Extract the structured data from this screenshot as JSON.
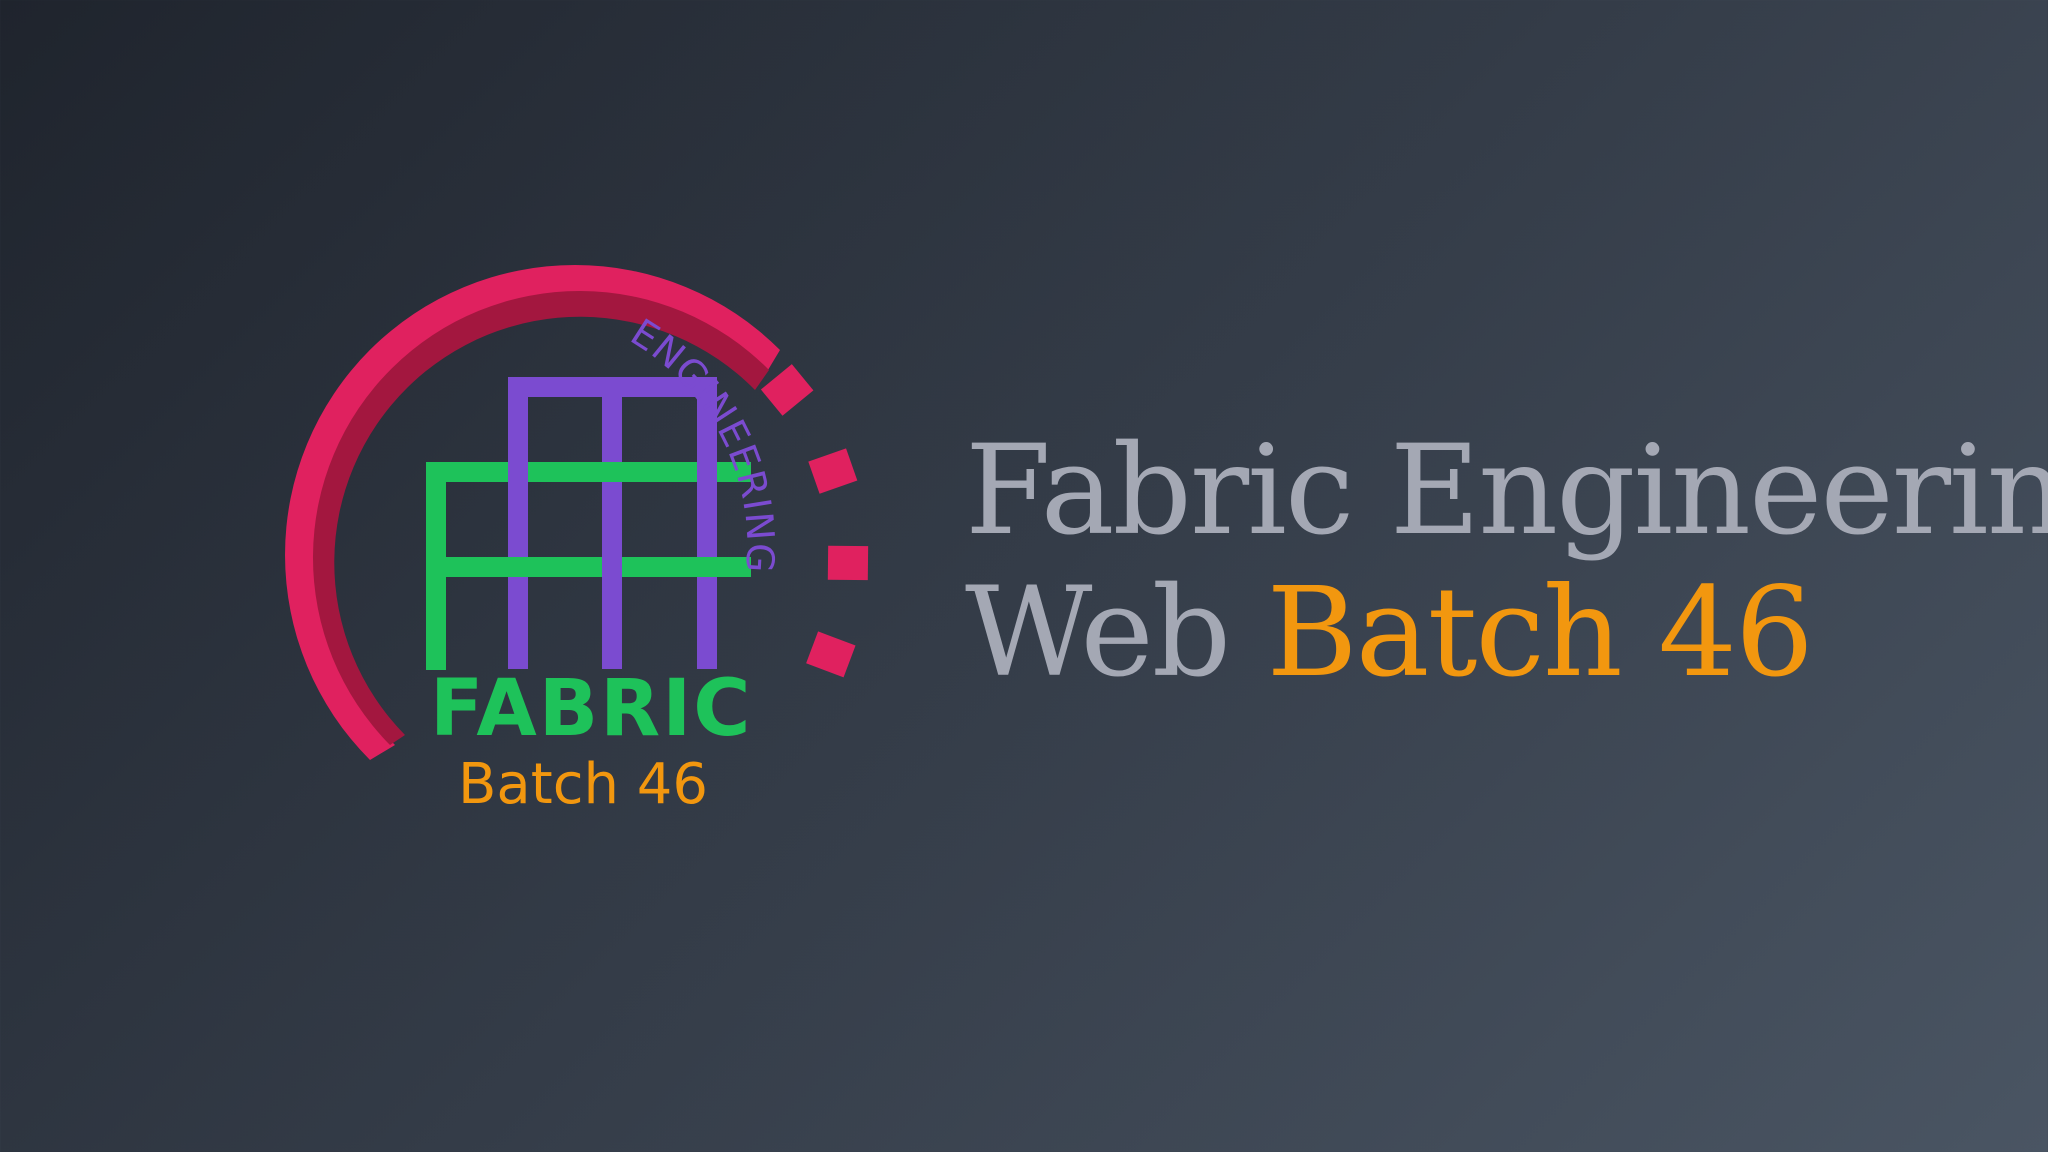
{
  "logo": {
    "ring_text": "ENGINEERING",
    "wordmark": "FABRIC",
    "batch": "Batch 46",
    "colors": {
      "gear": "#e0215f",
      "gear_shadow": "#a3173f",
      "purple": "#7b4bd0",
      "green": "#1ec25a",
      "orange": "#f2970f"
    }
  },
  "headline": {
    "line1": "Fabric Engineering",
    "line2_prefix": "Web",
    "line2_accent": "Batch 46"
  },
  "colors": {
    "text_gray": "#a4a8b4",
    "accent": "#f2970f",
    "bg_start": "#1f242d",
    "bg_end": "#4a5563"
  }
}
